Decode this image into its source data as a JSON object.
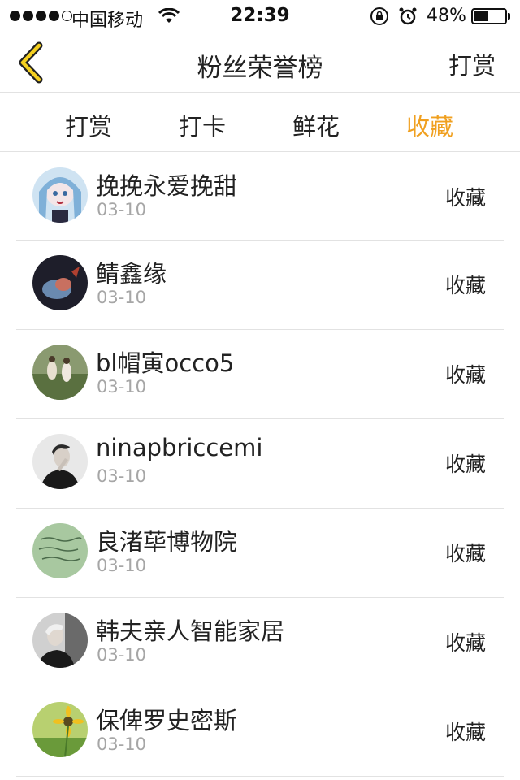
{
  "status_bar": {
    "carrier": "中国移动",
    "time": "22:39",
    "battery": "48%",
    "battery_level": 0.48
  },
  "nav": {
    "back_icon": "chevron-left-icon",
    "title": "粉丝荣誉榜",
    "right_label": "打赏"
  },
  "tabs": [
    {
      "label": "打赏"
    },
    {
      "label": "打卡"
    },
    {
      "label": "鲜花"
    },
    {
      "label": "收藏"
    }
  ],
  "active_tab": 3,
  "accent_color": "#f0a020",
  "list": [
    {
      "name": "挽挽永爱挽甜",
      "date": "03-10",
      "action": "收藏"
    },
    {
      "name": "鲭鑫缘",
      "date": "03-10",
      "action": "收藏"
    },
    {
      "name": "bl帽寅occo5",
      "date": "03-10",
      "action": "收藏"
    },
    {
      "name": "ninapbriccemi",
      "date": "03-10",
      "action": "收藏"
    },
    {
      "name": "良渚荜博物院",
      "date": "03-10",
      "action": "收藏"
    },
    {
      "name": "韩夫亲人智能家居",
      "date": "03-10",
      "action": "收藏"
    },
    {
      "name": "保俾罗史密斯",
      "date": "03-10",
      "action": "收藏"
    }
  ]
}
